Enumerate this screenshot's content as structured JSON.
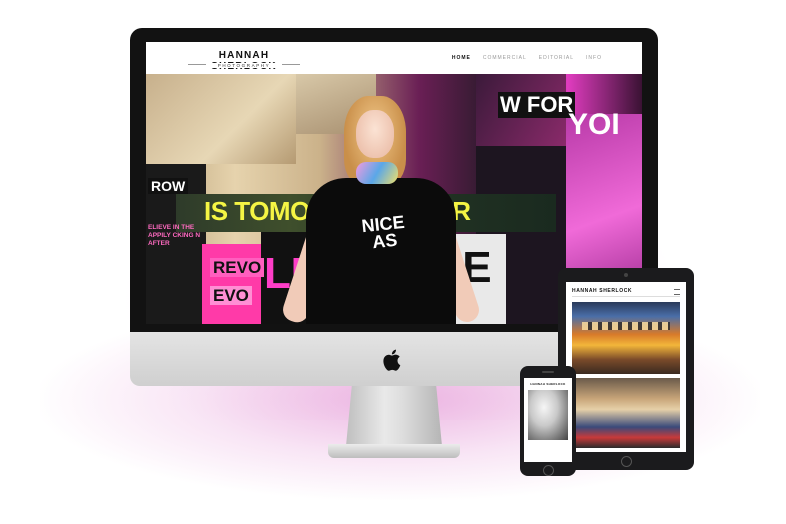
{
  "desktop_site": {
    "brand": {
      "name": "HANNAH SHERLOCK",
      "tagline": "PHOTOGRAPHY"
    },
    "nav": [
      {
        "label": "HOME",
        "active": true
      },
      {
        "label": "COMMERCIAL",
        "active": false
      },
      {
        "label": "EDITORIAL",
        "active": false
      },
      {
        "label": "INFO",
        "active": false
      }
    ],
    "hero_collage_text": {
      "row": "ROW",
      "small": "ELIEVE IN THE APPILY CKING N AFTER",
      "headline_left": "IS TOMO",
      "headline_right": "OR",
      "revo": "REVO",
      "evo": "EVO",
      "lut": "LUT",
      "ie": "IE",
      "top_w": "W FOR",
      "top_right": "YOI",
      "shirt": "NICE AS"
    }
  },
  "tablet_site": {
    "brand": "HANNAH SHERLOCK"
  },
  "phone_site": {
    "brand": "HANNAH SHERLOCK"
  },
  "colors": {
    "accent_yellow": "#f5f544",
    "accent_pink": "#ff3ec8",
    "glow": "#dd7ecc"
  }
}
